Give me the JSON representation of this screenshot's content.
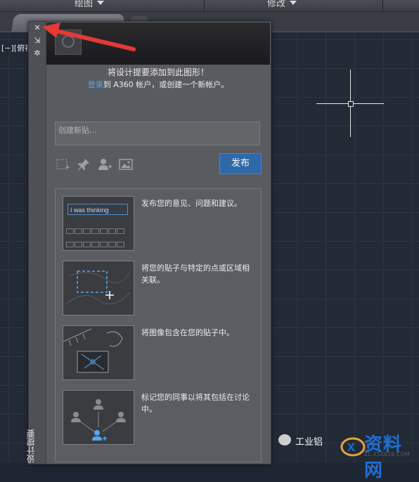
{
  "ribbon": {
    "draw_label": "绘图",
    "modify_label": "修改"
  },
  "viewport": {
    "view_label": "[−][俯视"
  },
  "palette": {
    "side_title": "设计提要",
    "close_glyph": "✕",
    "autohide_glyph": "⇲",
    "settings_glyph": "✲",
    "intro_line1": "将设计提要添加到此图形！",
    "intro_link": "登录",
    "intro_line2": "到 A360 帐户，或创建一个新帐户。",
    "new_post_placeholder": "创建新贴...",
    "publish_label": "发布",
    "tool_icons": [
      "select-area-icon",
      "pin-icon",
      "add-user-icon",
      "image-icon"
    ],
    "tips": [
      {
        "text": "发布您的意见、问题和建议。",
        "screen_text": "I was thinking"
      },
      {
        "text": "将您的贴子与特定的点或区域相关联。"
      },
      {
        "text": "将图像包含在您的贴子中。"
      },
      {
        "text": "标记您的同事以将其包括在讨论中。"
      }
    ]
  },
  "watermark": {
    "left_text": "工业铝",
    "logo_text": "资料网",
    "logo_sub": "ZL.XS1616.COM"
  },
  "colors": {
    "accent": "#2f6aa8",
    "link": "#56a6f0",
    "arrow": "#e53935"
  }
}
